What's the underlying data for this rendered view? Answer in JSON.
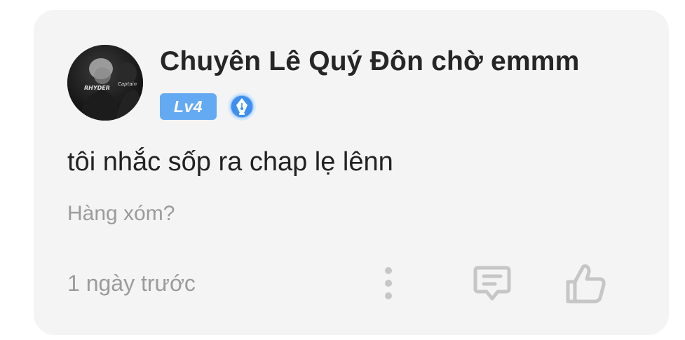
{
  "comment": {
    "username": "Chuyên Lê Quý Đôn chờ emmm",
    "level": "Lv4",
    "text": "tôi nhắc sốp ra chap lẹ lênn",
    "reply_context": "Hàng xóm?",
    "timestamp": "1 ngày trước",
    "avatar_text_left": "RHYDER",
    "avatar_text_right": "Captain"
  },
  "icons": {
    "badge": "pen-nib-badge-icon",
    "more": "more-vertical-icon",
    "reply": "comment-icon",
    "like": "thumbs-up-icon"
  },
  "colors": {
    "card_background": "#f4f4f4",
    "level_badge": "#64aaf2",
    "pen_badge": "#3f8ff0",
    "secondary_text": "#9b9b9b",
    "icon_gray": "#c6c6c6"
  }
}
